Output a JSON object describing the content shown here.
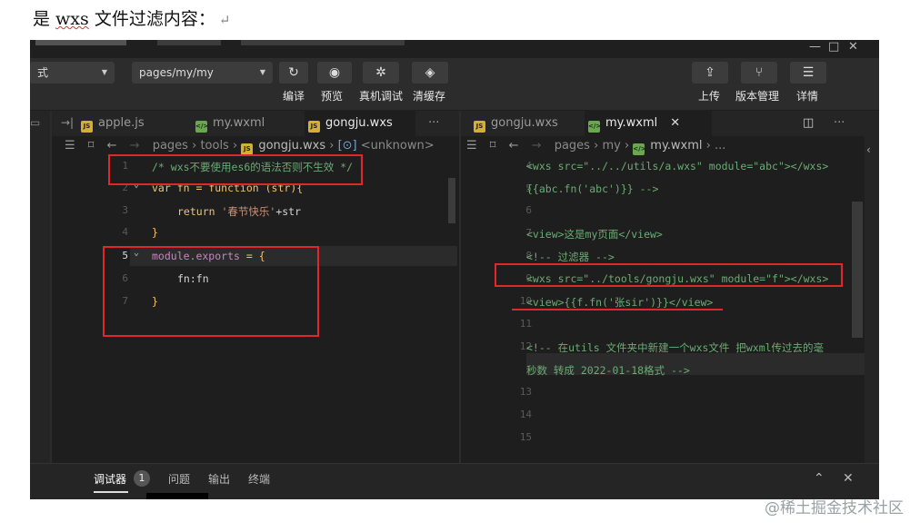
{
  "doc": {
    "prefix": "是 ",
    "word": "wxs",
    "suffix": " 文件过滤内容：",
    "return_mark": "↵"
  },
  "toolbar": {
    "mode_value": "式",
    "page_path_value": "pages/my/my",
    "compile_label": "编译",
    "preview_label": "预览",
    "device_debug_label": "真机调试",
    "clear_cache_label": "清缓存",
    "upload_label": "上传",
    "version_label": "版本管理",
    "details_label": "详情"
  },
  "left_editor": {
    "tabs": [
      {
        "name": "apple.js",
        "type": "js"
      },
      {
        "name": "my.wxml",
        "type": "wxml"
      },
      {
        "name": "gongju.wxs",
        "type": "js"
      }
    ],
    "more": "···",
    "breadcrumb": {
      "p1": "pages",
      "p2": "tools",
      "p3": "gongju.wxs",
      "p4": "<unknown>"
    },
    "lines": [
      {
        "n": "1",
        "text": "/* wxs不要使用es6的语法否则不生效 */"
      },
      {
        "n": "2",
        "a": "var fn = ",
        "b": "function",
        "c": " (str){"
      },
      {
        "n": "3",
        "a": "return ",
        "b": "'春节快乐'",
        "c": "+str"
      },
      {
        "n": "4",
        "text": "}"
      },
      {
        "n": "5",
        "a": "module.exports",
        "b": " = {"
      },
      {
        "n": "6",
        "text": "fn:fn"
      },
      {
        "n": "7",
        "text": "}"
      }
    ]
  },
  "right_editor": {
    "tabs": [
      {
        "name": "gongju.wxs",
        "type": "js"
      },
      {
        "name": "my.wxml",
        "type": "wxml"
      }
    ],
    "close": "✕",
    "more": "···",
    "breadcrumb": {
      "p1": "pages",
      "p2": "my",
      "p3": "my.wxml",
      "p4": "..."
    },
    "lines": [
      {
        "n": "4",
        "text": "<wxs src=\"../../utils/a.wxs\" module=\"abc\"></wxs>"
      },
      {
        "n": "5",
        "text": "{{abc.fn('abc')}} -->"
      },
      {
        "n": "6",
        "text": ""
      },
      {
        "n": "7",
        "text": "<view>这是my页面</view>"
      },
      {
        "n": "8",
        "text": "<!-- 过滤器 -->"
      },
      {
        "n": "9",
        "text": "<wxs src=\"../tools/gongju.wxs\" module=\"f\"></wxs>"
      },
      {
        "n": "10",
        "text": "<view>{{f.fn('张sir')}}</view>"
      },
      {
        "n": "11",
        "text": ""
      },
      {
        "n": "12",
        "text": "<!-- 在utils 文件夹中新建一个wxs文件 把wxml传过去的毫"
      },
      {
        "n": "",
        "text": "秒数 转成 2022-01-18格式 -->"
      },
      {
        "n": "13",
        "text": ""
      },
      {
        "n": "14",
        "text": ""
      },
      {
        "n": "15",
        "text": ""
      }
    ]
  },
  "bottom_panel": {
    "debugger_label": "调试器",
    "debugger_count": "1",
    "problems_label": "问题",
    "output_label": "输出",
    "terminal_label": "终端"
  },
  "watermark": "@稀土掘金技术社区"
}
